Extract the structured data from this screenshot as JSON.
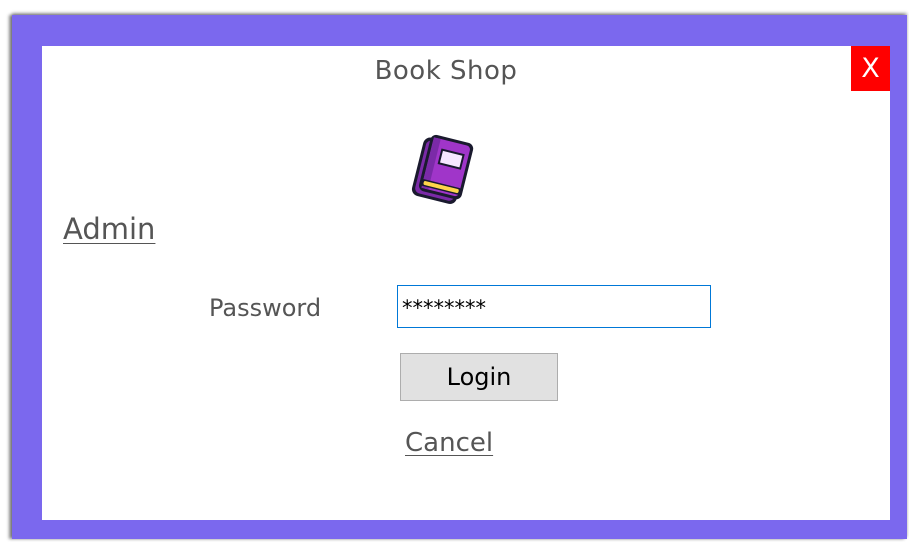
{
  "window": {
    "title": "Book Shop",
    "close_label": "X"
  },
  "logo": {
    "icon": "book-icon"
  },
  "login": {
    "role_label": "Admin",
    "password_label": "Password",
    "password_value": "********",
    "login_button": "Login",
    "cancel_link": "Cancel"
  },
  "colors": {
    "frame": "#7b68ee",
    "close_button": "#ff0000",
    "input_border": "#0078d7"
  }
}
